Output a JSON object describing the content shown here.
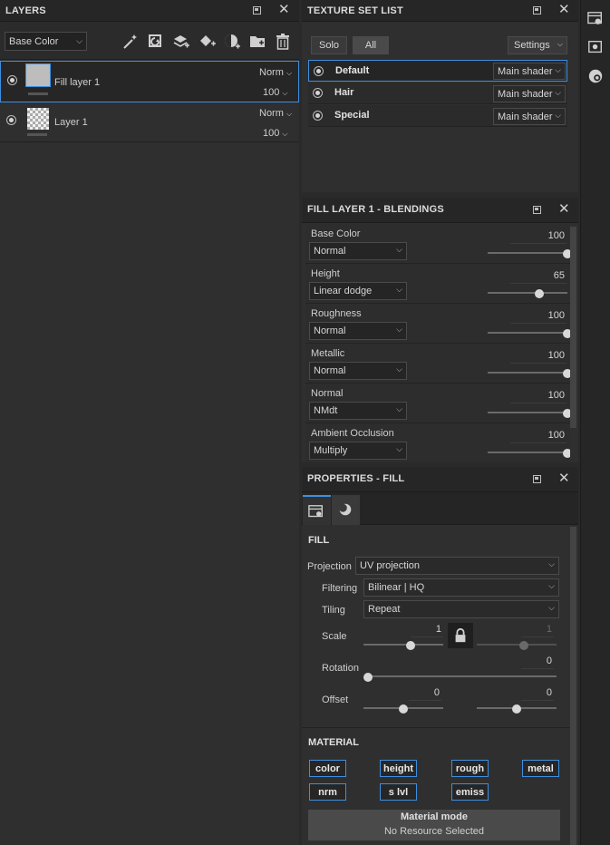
{
  "layers": {
    "title": "LAYERS",
    "channel": "Base Color",
    "items": [
      {
        "name": "Fill layer 1",
        "blend": "Norm",
        "opacity": "100"
      },
      {
        "name": "Layer 1",
        "blend": "Norm",
        "opacity": "100"
      }
    ]
  },
  "texture_set": {
    "title": "TEXTURE SET LIST",
    "solo_label": "Solo",
    "all_label": "All",
    "settings_label": "Settings",
    "sets": [
      {
        "name": "Default",
        "shader": "Main shader"
      },
      {
        "name": "Hair",
        "shader": "Main shader"
      },
      {
        "name": "Special",
        "shader": "Main shader"
      }
    ]
  },
  "blendings": {
    "title": "FILL LAYER 1 - BLENDINGS",
    "channels": [
      {
        "name": "Base Color",
        "mode": "Normal",
        "value": "100",
        "fraction": 1.0
      },
      {
        "name": "Height",
        "mode": "Linear dodge",
        "value": "65",
        "fraction": 0.65
      },
      {
        "name": "Roughness",
        "mode": "Normal",
        "value": "100",
        "fraction": 1.0
      },
      {
        "name": "Metallic",
        "mode": "Normal",
        "value": "100",
        "fraction": 1.0
      },
      {
        "name": "Normal",
        "mode": "NMdt",
        "value": "100",
        "fraction": 1.0
      },
      {
        "name": "Ambient Occlusion",
        "mode": "Multiply",
        "value": "100",
        "fraction": 1.0
      }
    ]
  },
  "properties": {
    "title": "PROPERTIES - FILL",
    "fill_heading": "FILL",
    "projection_label": "Projection",
    "projection_value": "UV projection",
    "filtering_label": "Filtering",
    "filtering_value": "Bilinear | HQ",
    "tiling_label": "Tiling",
    "tiling_value": "Repeat",
    "scale_label": "Scale",
    "scale_u": "1",
    "scale_v": "1",
    "rotation_label": "Rotation",
    "rotation_value": "0",
    "offset_label": "Offset",
    "offset_u": "0",
    "offset_v": "0",
    "material_heading": "MATERIAL",
    "material_buttons": [
      "color",
      "height",
      "rough",
      "metal",
      "nrm",
      "s lvl",
      "emiss"
    ],
    "material_mode_title": "Material mode",
    "material_mode_status": "No Resource Selected"
  },
  "colors": {
    "accent": "#3e8fe0",
    "panel": "#2f2f2f",
    "header": "#262626"
  }
}
